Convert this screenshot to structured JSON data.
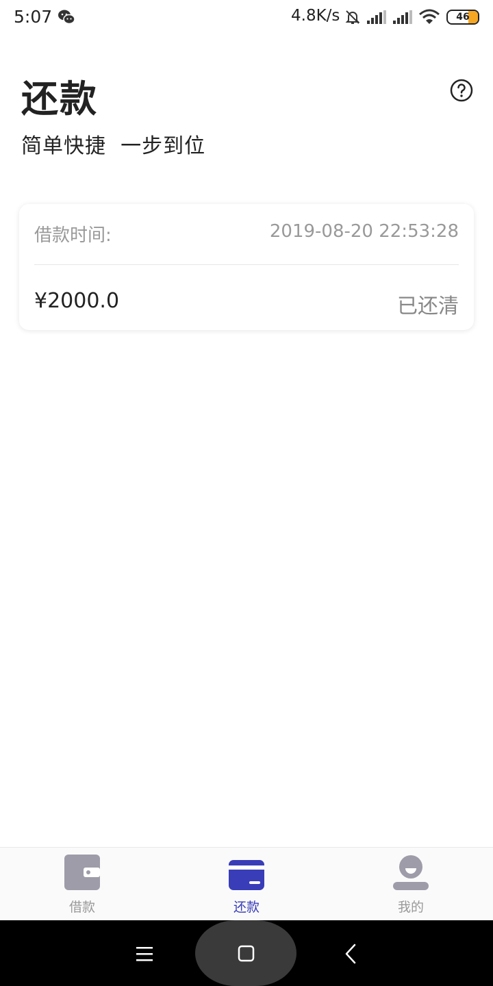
{
  "status_bar": {
    "time": "5:07",
    "network_speed": "4.8K/s",
    "battery": "46",
    "icons": [
      "wechat-icon",
      "bell-muted-icon",
      "signal-icon",
      "signal-icon",
      "wifi-icon",
      "battery-icon"
    ]
  },
  "header": {
    "title": "还款",
    "subtitle": "简单快捷  一步到位",
    "help_icon": "help-circle-icon"
  },
  "loan_card": {
    "time_label": "借款时间:",
    "time_value": "2019-08-20 22:53:28",
    "amount": "¥2000.0",
    "status": "已还清"
  },
  "tab_bar": {
    "tabs": [
      {
        "label": "借款",
        "icon": "wallet-icon",
        "active": false
      },
      {
        "label": "还款",
        "icon": "card-icon",
        "active": true
      },
      {
        "label": "我的",
        "icon": "profile-icon",
        "active": false
      }
    ]
  },
  "nav_bar": {
    "icons": [
      "menu-icon",
      "home-icon",
      "back-icon"
    ]
  },
  "colors": {
    "accent": "#3a3db8",
    "inactive": "#9e9ca8",
    "muted_text": "#999999"
  }
}
